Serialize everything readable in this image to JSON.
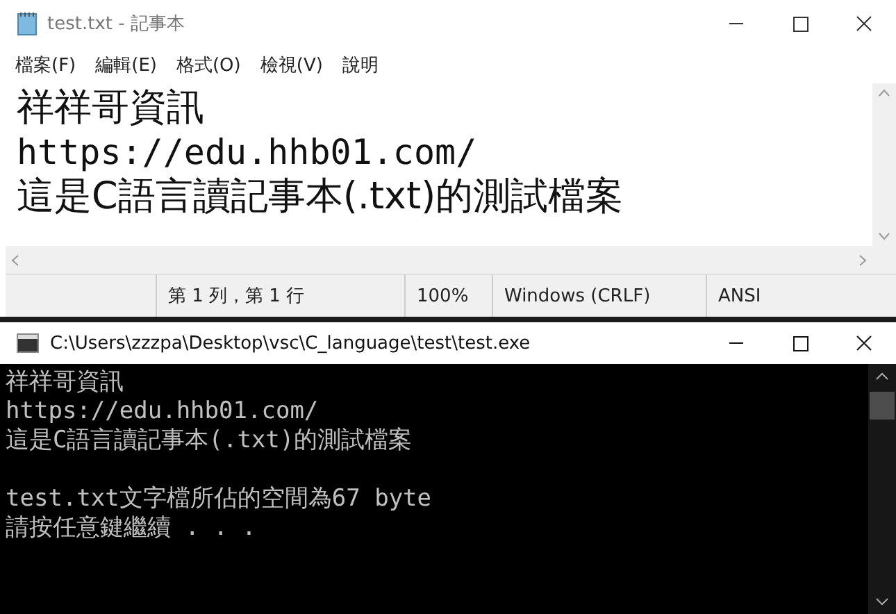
{
  "notepad": {
    "title": "test.txt - 記事本",
    "menu": [
      "檔案(F)",
      "編輯(E)",
      "格式(O)",
      "檢視(V)",
      "說明"
    ],
    "lines": [
      "祥祥哥資訊",
      "https://edu.hhb01.com/",
      "這是C語言讀記事本(.txt)的測試檔案"
    ],
    "status_bar": [
      "第 1 列，第 1 行",
      "100%",
      "Windows (CRLF)",
      "ANSI"
    ]
  },
  "console": {
    "title": "C:\\Users\\zzzpa\\Desktop\\vsc\\C_language\\test\\test.exe",
    "output_blocks": [
      [
        "祥祥哥資訊",
        "https://edu.hhb01.com/",
        "這是C語言讀記事本(.txt)的測試檔案"
      ],
      [
        "test.txt文字檔所佔的空間為67 byte",
        "請按任意鍵繼續 . . ."
      ]
    ]
  }
}
